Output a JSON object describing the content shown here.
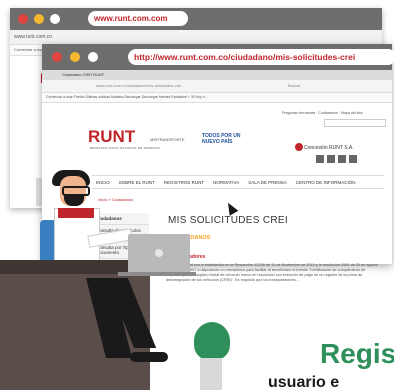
{
  "back_window": {
    "url": "www.runt.com.com",
    "nav_url": "www.runt.com.co",
    "bookmarks": "Comenzar a usar Firefox",
    "logo": "RU"
  },
  "front_window": {
    "tab_label": "Ciudadano CREI RUNT",
    "url": "http://www.runt.com.co/ciudadano/mis-solicitudes-crei",
    "nav_url": "www.runt.com.co/ciudadano/mis-solicitudes-crei",
    "search_placeholder": "Buscar",
    "bookmarks": "Comenzar a usar Firefox  Últimas noticias  Muestra Descargar  Descargar fuentes  Radiomiel + 30 Hoy h..."
  },
  "page": {
    "top_links": "Preguntas frecuentes · Contáctenos · Mapa del sitio",
    "logo": "RUNT",
    "logo_sub": "REGISTRO ÚNICO NACIONAL DE TRÁNSITO",
    "ministry": "MINTRANSPORTE",
    "slogan": "TODOS POR UN NUEVO PAÍS",
    "consortium": "Concesión RUNT S.A.",
    "menu": [
      "INICIO",
      "SOBRE EL RUNT",
      "REGISTROS RUNT",
      "NORMATIVA",
      "SALA DE PRENSA",
      "CENTRO DE INFORMACIÓN"
    ],
    "breadcrumb": "Inicio » Ciudadanos",
    "sidebar": [
      "Ciudadanos",
      "Consulta de Vehículos por Placa",
      "Consulta por Tipo de Documento",
      "Consulta de Infracciones"
    ],
    "title": "MIS SOLICITUDES CREI",
    "section": "CIUDADANOS",
    "section_sub": "Transportadores",
    "body": "De conformidad con lo establecido en la Resolución 12336 de 11 de Noviembre de 2015 y la resolución 3981 de 20 de agosto de 2016, el RUNT a disposición un mecanismo para facilitar al beneficiario el trámite \"Certificación de cumplimiento de requisitos para el registro inicial de vehículo nuevo en reposición con exención de pago de un registro de la prima de desintegración de los vehículos (CREI)\". Es requisito que los transportadores..."
  },
  "bottom": {
    "headline": "Regis",
    "subline": "usuario e"
  },
  "colors": {
    "runt_red": "#c0252b",
    "green": "#2f8f5a",
    "orange": "#f7a11a"
  }
}
